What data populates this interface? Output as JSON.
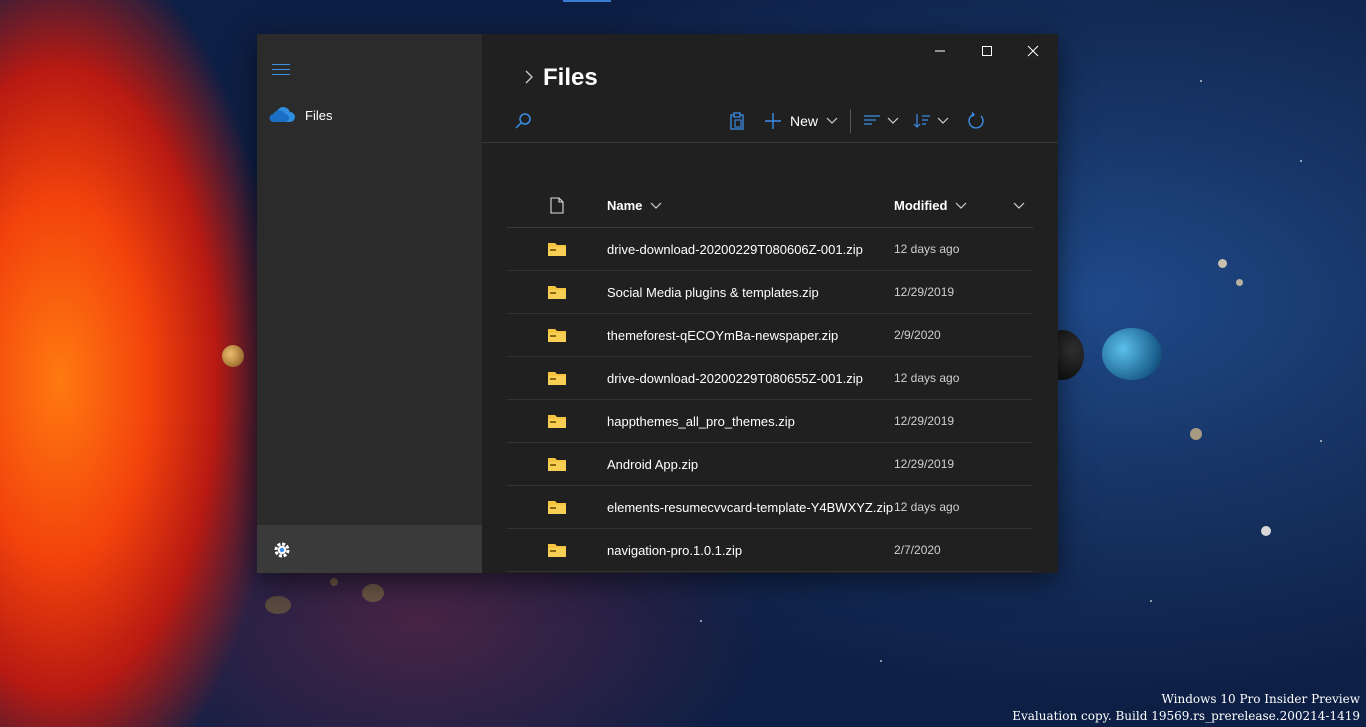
{
  "colors": {
    "accent": "#3a8ee6",
    "folder": "#f5c440",
    "window_bg": "#202020",
    "sidebar_bg": "#2b2b2b"
  },
  "sidebar": {
    "menu_icon": "hamburger-icon",
    "items": [
      {
        "label": "Files",
        "icon": "onedrive-cloud-icon"
      }
    ],
    "settings_icon": "gear-icon"
  },
  "header": {
    "title": "Files"
  },
  "toolbar": {
    "paste_icon": "clipboard-icon",
    "new_label": "New",
    "view_icon": "view-lines-icon",
    "sort_icon": "sort-icon",
    "refresh_icon": "refresh-icon"
  },
  "table": {
    "columns": {
      "name": "Name",
      "modified": "Modified"
    },
    "rows": [
      {
        "name": "drive-download-20200229T080606Z-001.zip",
        "modified": "12 days ago"
      },
      {
        "name": "Social Media plugins & templates.zip",
        "modified": "12/29/2019"
      },
      {
        "name": "themeforest-qECOYmBa-newspaper.zip",
        "modified": "2/9/2020"
      },
      {
        "name": "drive-download-20200229T080655Z-001.zip",
        "modified": "12 days ago"
      },
      {
        "name": "happthemes_all_pro_themes.zip",
        "modified": "12/29/2019"
      },
      {
        "name": "Android App.zip",
        "modified": "12/29/2019"
      },
      {
        "name": "elements-resumecvvcard-template-Y4BWXYZ.zip",
        "modified": "12 days ago"
      },
      {
        "name": "navigation-pro.1.0.1.zip",
        "modified": "2/7/2020"
      }
    ]
  },
  "watermark": {
    "line1": "Windows 10 Pro Insider Preview",
    "line2": "Evaluation copy. Build 19569.rs_prerelease.200214-1419"
  }
}
